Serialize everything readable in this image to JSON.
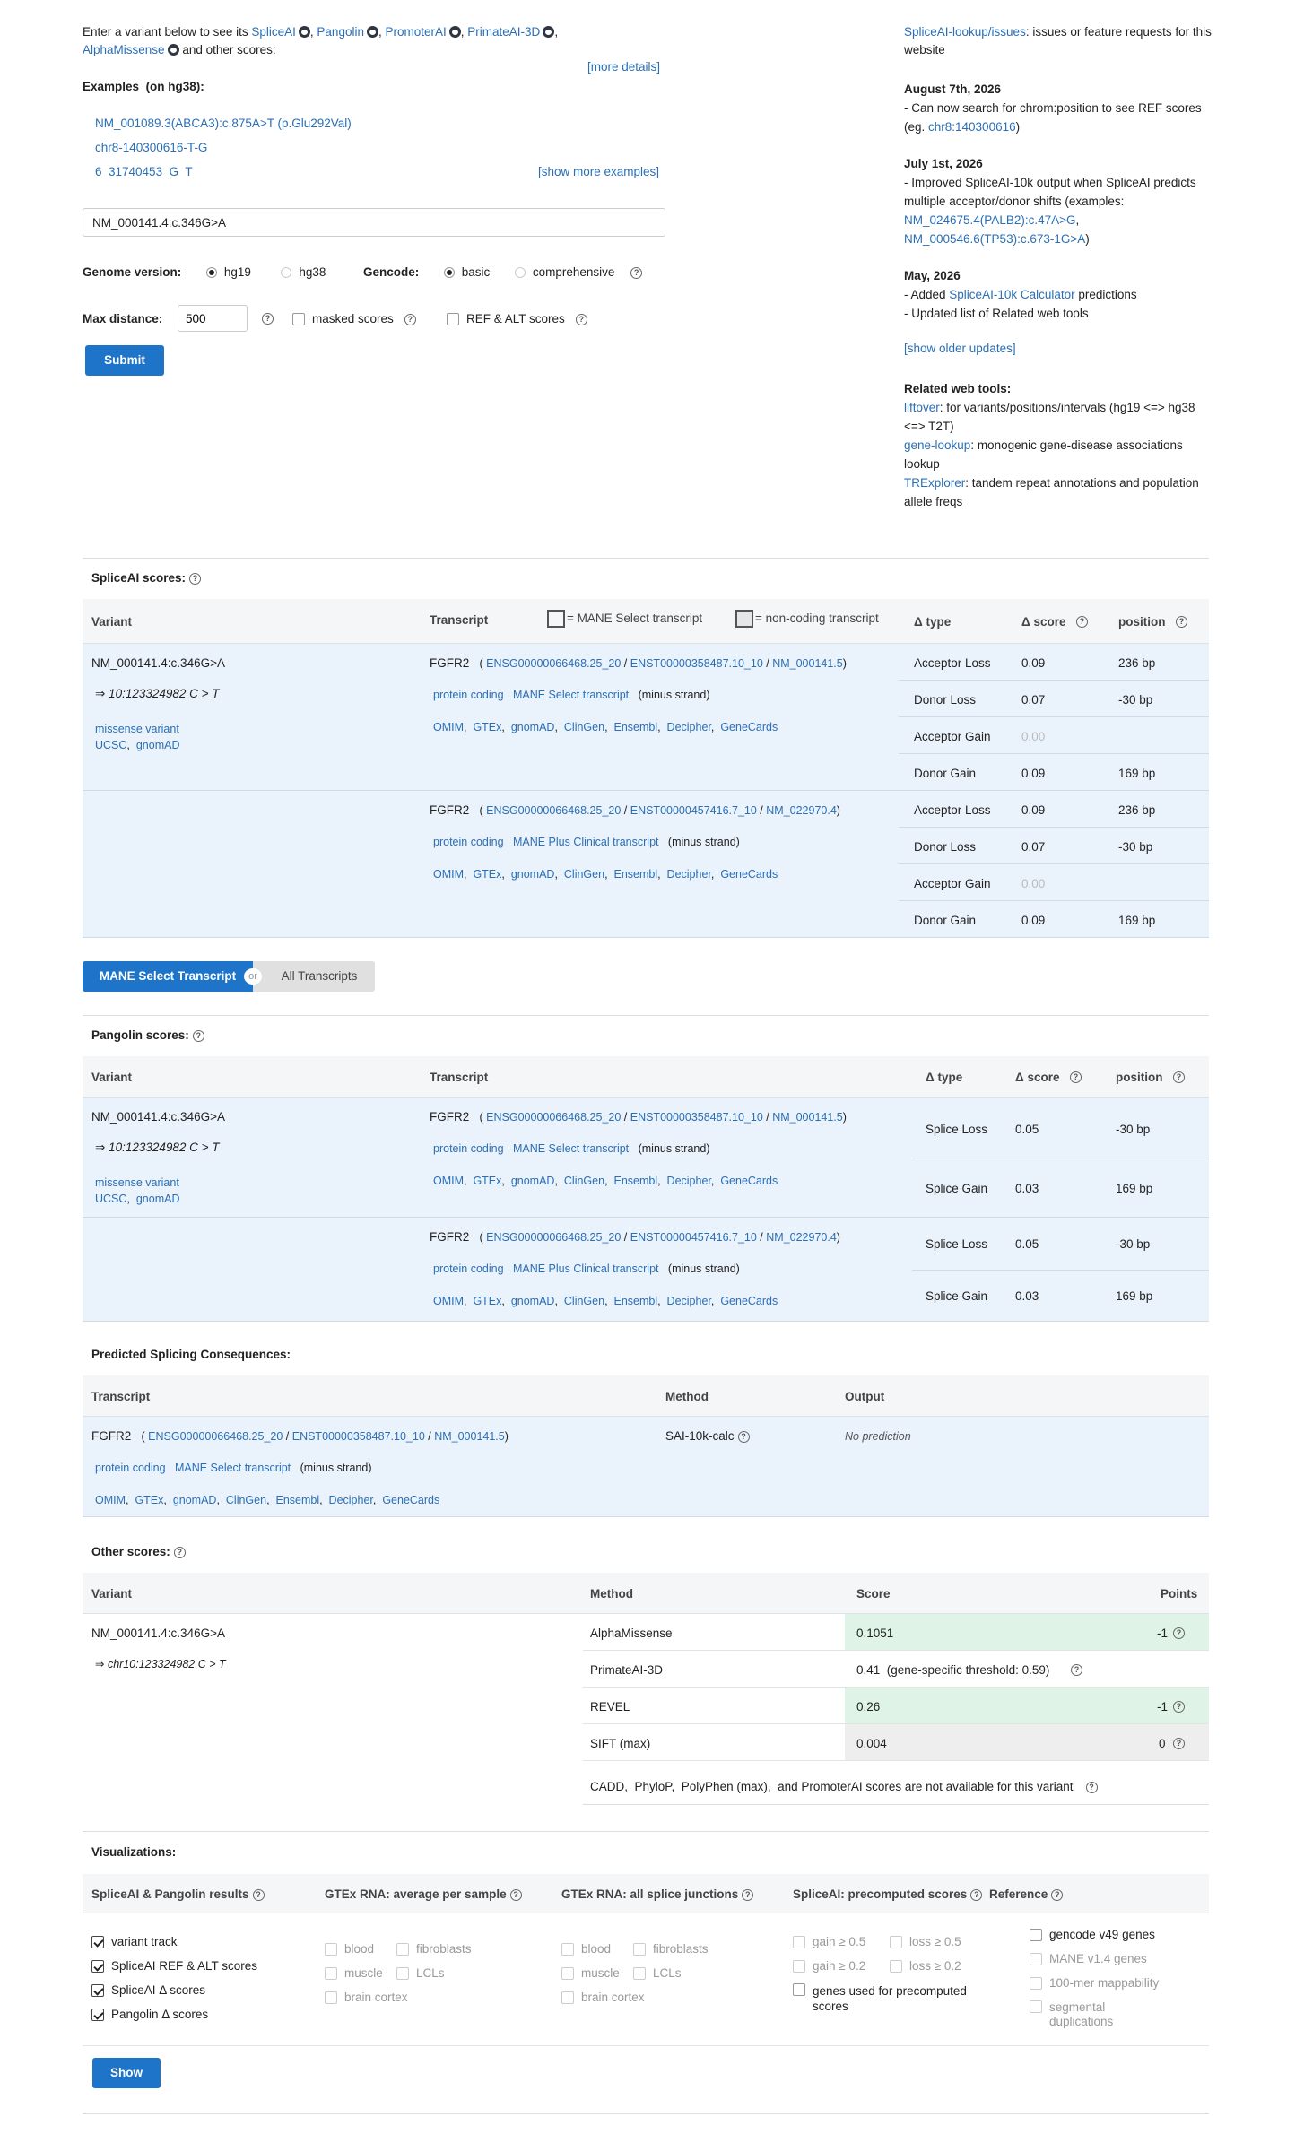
{
  "intro": {
    "text_prefix": "Enter a variant below to see its",
    "tools": [
      "SpliceAI",
      "Pangolin",
      "PromoterAI",
      "PrimateAI-3D",
      "AlphaMissense"
    ],
    "text_suffix": "and other scores:",
    "more_details": "[more details]"
  },
  "examples": {
    "label": "Examples",
    "build": "(on hg38):",
    "items": [
      "NM_001089.3(ABCA3):c.875A>T (p.Glu292Val)",
      "chr8-140300616-T-G",
      "6  31740453  G  T"
    ],
    "show_more": "[show more examples]"
  },
  "search": {
    "value": "NM_000141.4:c.346G>A"
  },
  "genome": {
    "label": "Genome version:",
    "options": [
      "hg19",
      "hg38"
    ],
    "selected": "hg19"
  },
  "gencode": {
    "label": "Gencode:",
    "options": [
      "basic",
      "comprehensive"
    ],
    "selected": "basic"
  },
  "maxdist": {
    "label": "Max distance:",
    "value": "500",
    "masked": "masked scores",
    "refalt": "REF & ALT scores"
  },
  "submit": "Submit",
  "news": {
    "issues_link": "SpliceAI-lookup/issues",
    "issues_text": ": issues or feature requests for this website",
    "updates": [
      {
        "date": "August 7th, 2026",
        "lines": [
          "- Can now search for chrom:position to see REF scores (eg. ",
          "chr8:140300616",
          ")"
        ]
      },
      {
        "date": "July 1st, 2026",
        "lines": [
          "- Improved SpliceAI-10k output when SpliceAI predicts multiple acceptor/donor shifts (examples: ",
          "NM_024675.4(PALB2):c.47A>G",
          ", ",
          "NM_000546.6(TP53):c.673-1G>A",
          ")"
        ]
      },
      {
        "date": "May, 2026",
        "lines": [
          "- Added ",
          "SpliceAI-10k Calculator",
          " predictions",
          "- Updated list of Related web tools"
        ]
      }
    ],
    "show_older": "[show older updates]",
    "related_title": "Related web tools:",
    "related": [
      {
        "link": "liftover",
        "text": ": for variants/positions/intervals (hg19 <=> hg38 <=> T2T)"
      },
      {
        "link": "gene-lookup",
        "text": ": monogenic gene-disease associations lookup"
      },
      {
        "link": "TRExplorer",
        "text": ": tandem repeat annotations and population allele freqs"
      }
    ]
  },
  "spliceai": {
    "title": "SpliceAI scores:",
    "cols": {
      "variant": "Variant",
      "transcript": "Transcript",
      "mane_legend": "= MANE Select transcript",
      "noncoding_legend": "= non-coding transcript",
      "dtype": "Δ type",
      "score": "Δ score",
      "position": "position"
    },
    "variant": {
      "name": "NM_000141.4:c.346G>A",
      "coord": "⇒ 10:123324982 C > T",
      "consequence": "missense variant",
      "links": [
        "UCSC",
        "gnomAD"
      ]
    },
    "transcripts": [
      {
        "gene": "FGFR2",
        "ids": [
          "ENSG00000066468.25_20",
          "ENST00000358487.10_10",
          "NM_000141.5"
        ],
        "biotype": "protein coding",
        "tag": "MANE Select transcript",
        "strand": "(minus strand)",
        "links": [
          "OMIM",
          "GTEx",
          "gnomAD",
          "ClinGen",
          "Ensembl",
          "Decipher",
          "GeneCards"
        ],
        "rows": [
          {
            "type": "Acceptor Loss",
            "score": "0.09",
            "pos": "236 bp"
          },
          {
            "type": "Donor Loss",
            "score": "0.07",
            "pos": "-30 bp"
          },
          {
            "type": "Acceptor Gain",
            "score": "0.00",
            "pos": ""
          },
          {
            "type": "Donor Gain",
            "score": "0.09",
            "pos": "169 bp"
          }
        ]
      },
      {
        "gene": "FGFR2",
        "ids": [
          "ENSG00000066468.25_20",
          "ENST00000457416.7_10",
          "NM_022970.4"
        ],
        "biotype": "protein coding",
        "tag": "MANE Plus Clinical transcript",
        "strand": "(minus strand)",
        "links": [
          "OMIM",
          "GTEx",
          "gnomAD",
          "ClinGen",
          "Ensembl",
          "Decipher",
          "GeneCards"
        ],
        "rows": [
          {
            "type": "Acceptor Loss",
            "score": "0.09",
            "pos": "236 bp"
          },
          {
            "type": "Donor Loss",
            "score": "0.07",
            "pos": "-30 bp"
          },
          {
            "type": "Acceptor Gain",
            "score": "0.00",
            "pos": ""
          },
          {
            "type": "Donor Gain",
            "score": "0.09",
            "pos": "169 bp"
          }
        ]
      }
    ]
  },
  "toggle": {
    "left": "MANE Select Transcript",
    "or": "or",
    "right": "All Transcripts"
  },
  "pangolin": {
    "title": "Pangolin scores:",
    "cols": {
      "variant": "Variant",
      "transcript": "Transcript",
      "dtype": "Δ type",
      "score": "Δ score",
      "position": "position"
    },
    "rows": [
      [
        {
          "type": "Splice Loss",
          "score": "0.05",
          "pos": "-30 bp"
        },
        {
          "type": "Splice Gain",
          "score": "0.03",
          "pos": "169 bp"
        }
      ],
      [
        {
          "type": "Splice Loss",
          "score": "0.05",
          "pos": "-30 bp"
        },
        {
          "type": "Splice Gain",
          "score": "0.03",
          "pos": "169 bp"
        }
      ]
    ]
  },
  "consequences": {
    "title": "Predicted Splicing Consequences:",
    "cols": {
      "transcript": "Transcript",
      "method": "Method",
      "output": "Output"
    },
    "method": "SAI-10k-calc",
    "output": "No prediction"
  },
  "other": {
    "title": "Other scores:",
    "cols": {
      "variant": "Variant",
      "method": "Method",
      "score": "Score",
      "points": "Points"
    },
    "variant": "NM_000141.4:c.346G>A",
    "coord": "⇒ chr10:123324982 C > T",
    "rows": [
      {
        "method": "AlphaMissense",
        "score": "0.1051",
        "points": "-1"
      },
      {
        "method": "PrimateAI-3D",
        "score": "0.41  (gene-specific threshold: 0.59)",
        "points": ""
      },
      {
        "method": "REVEL",
        "score": "0.26",
        "points": "-1"
      },
      {
        "method": "SIFT (max)",
        "score": "0.004",
        "points": "0"
      }
    ],
    "note": "CADD,  PhyloP,  PolyPhen (max),  and PromoterAI scores are not available for this variant"
  },
  "viz": {
    "title": "Visualizations:",
    "cols": [
      "SpliceAI & Pangolin results",
      "GTEx RNA: average per sample",
      "GTEx RNA: all splice junctions",
      "SpliceAI: precomputed scores",
      "Reference"
    ],
    "col1": [
      "variant track",
      "SpliceAI REF & ALT scores",
      "SpliceAI Δ  scores",
      "Pangolin Δ  scores"
    ],
    "tissues": [
      "blood",
      "fibroblasts",
      "muscle",
      "LCLs",
      "brain cortex"
    ],
    "precomp": [
      "gain ≥ 0.5",
      "loss ≥ 0.5",
      "gain ≥ 0.2",
      "loss ≥ 0.2"
    ],
    "precomp_genes": "genes used for precomputed scores",
    "ref": [
      "gencode v49 genes",
      "MANE v1.4 genes",
      "100-mer mappability",
      "segmental duplications"
    ],
    "show": "Show"
  }
}
